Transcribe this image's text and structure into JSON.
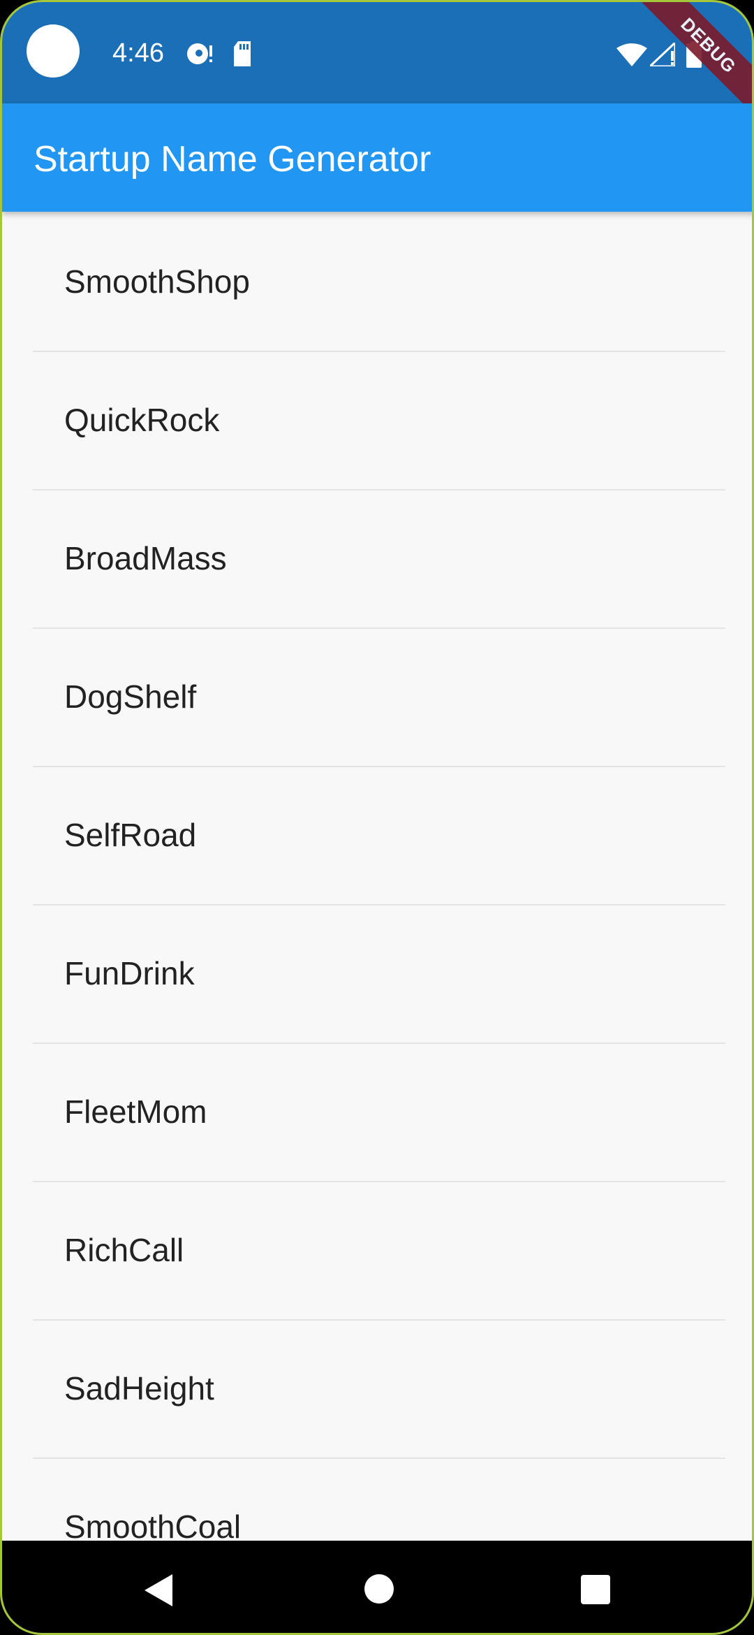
{
  "status_bar": {
    "time": "4:46",
    "left_icons": [
      "camera-dot",
      "disc-icon",
      "sd-card-icon"
    ],
    "right_icons": [
      "wifi-icon",
      "signal-icon",
      "battery-icon"
    ],
    "debug_label": "DEBUG"
  },
  "app_bar": {
    "title": "Startup Name Generator",
    "color": "#2196f3"
  },
  "list": {
    "items": [
      {
        "label": "SmoothShop"
      },
      {
        "label": "QuickRock"
      },
      {
        "label": "BroadMass"
      },
      {
        "label": "DogShelf"
      },
      {
        "label": "SelfRoad"
      },
      {
        "label": "FunDrink"
      },
      {
        "label": "FleetMom"
      },
      {
        "label": "RichCall"
      },
      {
        "label": "SadHeight"
      },
      {
        "label": "SmoothCoal"
      }
    ]
  },
  "nav_bar": {
    "buttons": [
      "back-icon",
      "home-icon",
      "recents-icon"
    ]
  }
}
